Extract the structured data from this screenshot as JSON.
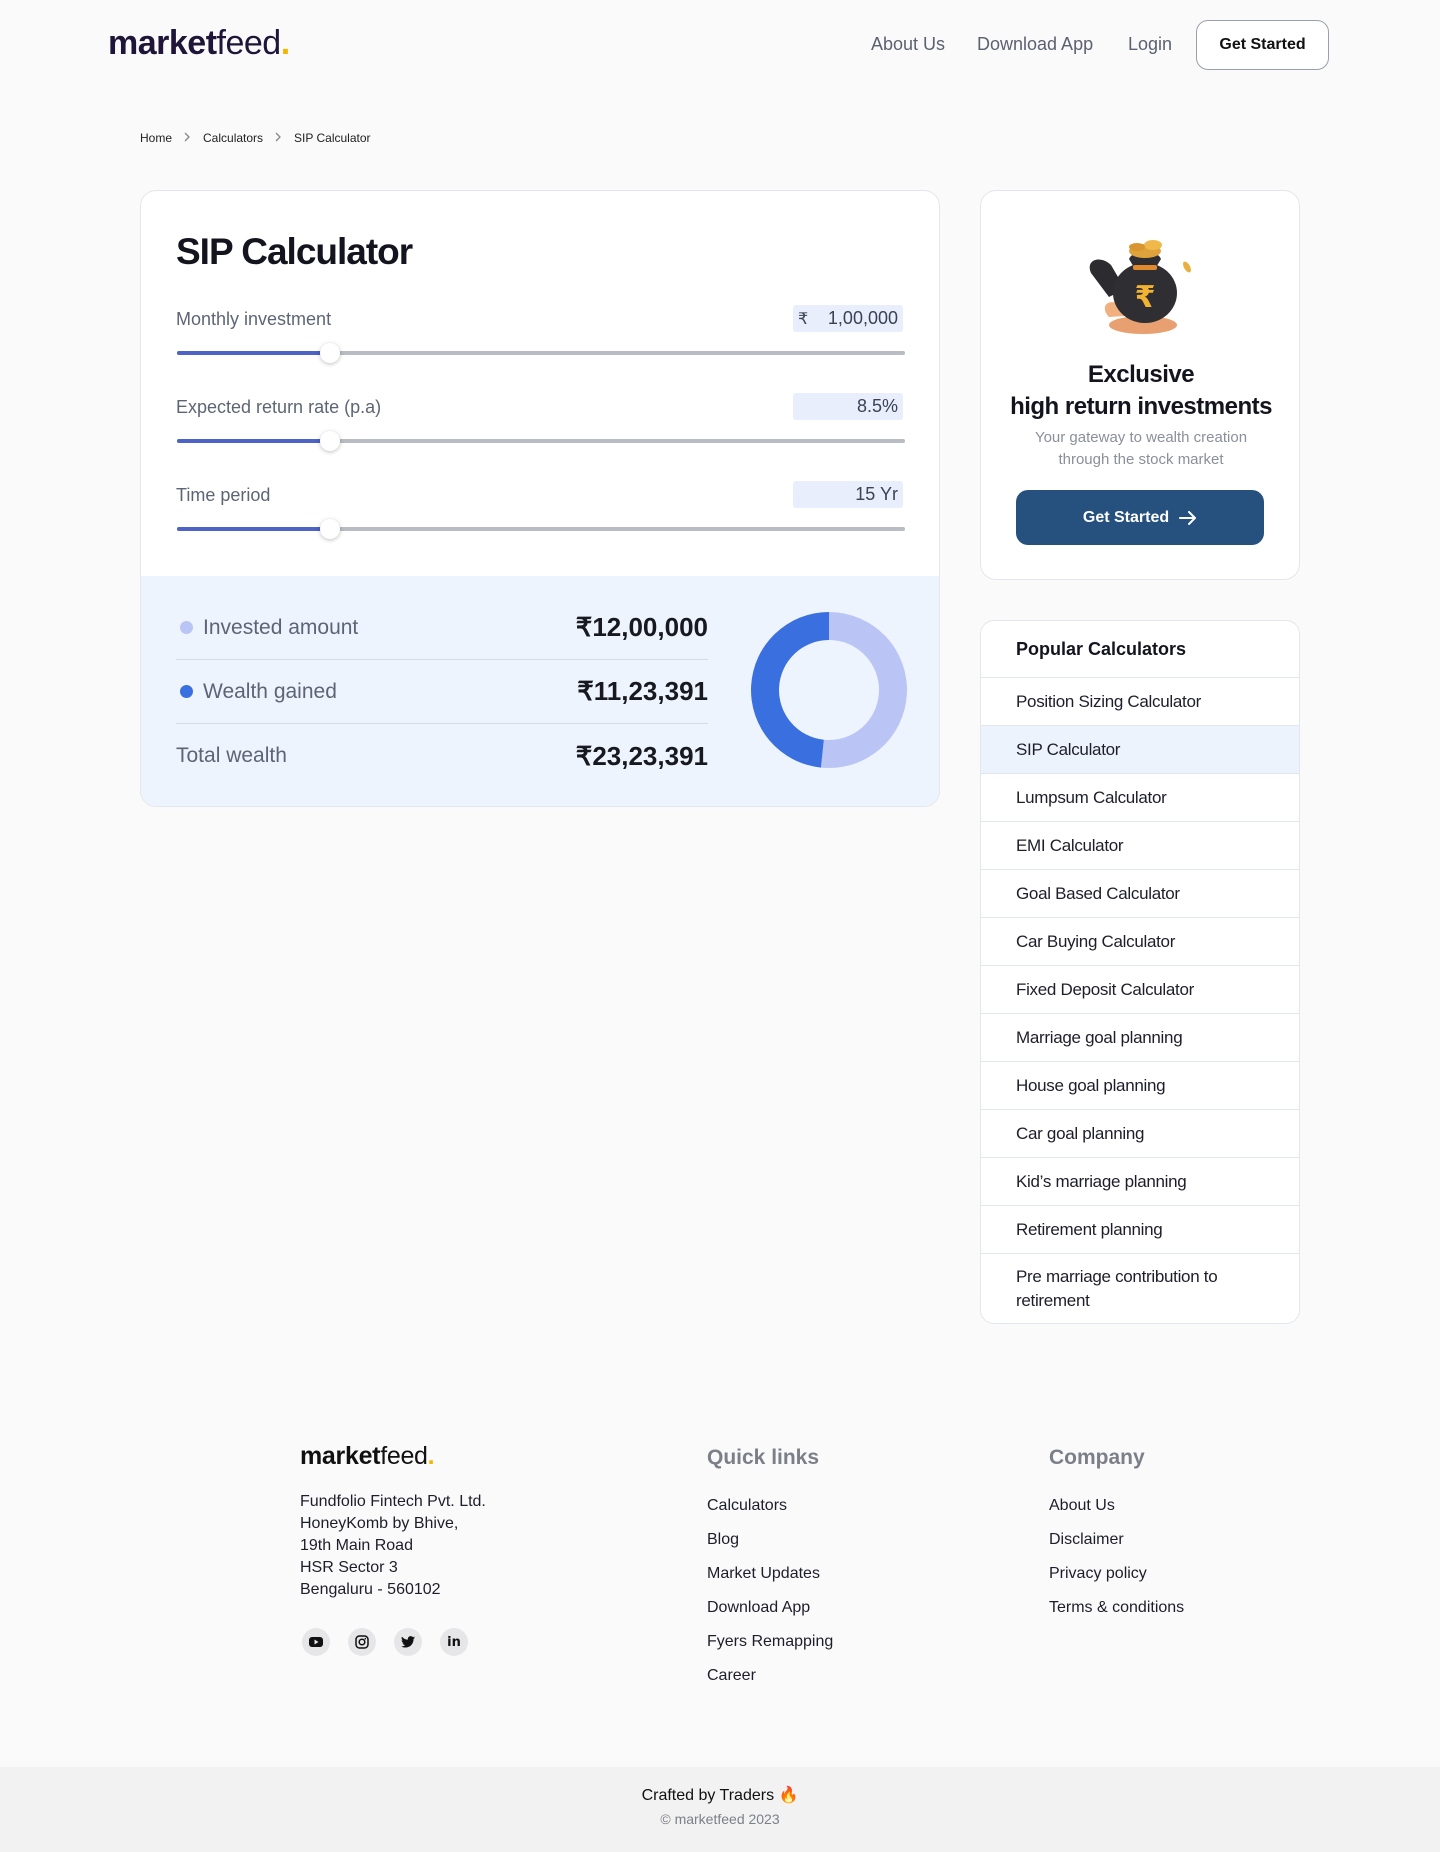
{
  "header": {
    "logo_brand": "market",
    "logo_suffix": "feed",
    "logo_dot": ".",
    "nav": [
      "About Us",
      "Download App",
      "Login"
    ],
    "cta": "Get Started"
  },
  "breadcrumb": [
    "Home",
    "Calculators",
    "SIP Calculator"
  ],
  "calculator": {
    "title": "SIP Calculator",
    "currency_symbol": "₹",
    "fields": [
      {
        "label": "Monthly investment",
        "value": "1,00,000",
        "slider_fraction": 0.21
      },
      {
        "label": "Expected return rate (p.a)",
        "value": "8.5%",
        "slider_fraction": 0.21
      },
      {
        "label": "Time period",
        "value": "15 Yr",
        "slider_fraction": 0.21
      }
    ],
    "results": {
      "invested_label": "Invested amount",
      "invested_value": "₹12,00,000",
      "gained_label": "Wealth gained",
      "gained_value": "₹11,23,391",
      "total_label": "Total wealth",
      "total_value": "₹23,23,391"
    },
    "donut": {
      "invested_amount": 1200000,
      "wealth_gained": 1123391,
      "invested_color": "#bac5f6",
      "gained_color": "#3a6fdf"
    }
  },
  "promo": {
    "title_line1": "Exclusive",
    "title_line2": "high return investments",
    "subtitle": "Your gateway to wealth creation through the stock market",
    "button": "Get Started",
    "art_icon": "money-bag-icon"
  },
  "popular": {
    "heading": "Popular Calculators",
    "active_index": 1,
    "items": [
      "Position Sizing Calculator",
      "SIP Calculator",
      "Lumpsum Calculator",
      "EMI Calculator",
      "Goal Based Calculator",
      "Car Buying Calculator",
      "Fixed Deposit Calculator",
      "Marriage goal planning",
      "House goal planning",
      "Car goal planning",
      "Kid’s marriage planning",
      "Retirement planning",
      "Pre marriage contribution to retirement"
    ]
  },
  "footer": {
    "logo_brand": "market",
    "logo_suffix": "feed",
    "logo_dot": ".",
    "address": [
      "Fundfolio Fintech Pvt. Ltd.",
      "HoneyKomb by Bhive,",
      "19th Main Road",
      "HSR Sector 3",
      "Bengaluru - 560102"
    ],
    "social": [
      "youtube-icon",
      "instagram-icon",
      "twitter-icon",
      "linkedin-icon"
    ],
    "quick_links_title": "Quick links",
    "quick_links": [
      "Calculators",
      "Blog",
      "Market Updates",
      "Download App",
      "Fyers Remapping",
      "Career"
    ],
    "company_title": "Company",
    "company_links": [
      "About Us",
      "Disclaimer",
      "Privacy policy",
      "Terms & conditions"
    ],
    "crafted": "Crafted by Traders 🔥",
    "copyright": "© marketfeed 2023"
  }
}
